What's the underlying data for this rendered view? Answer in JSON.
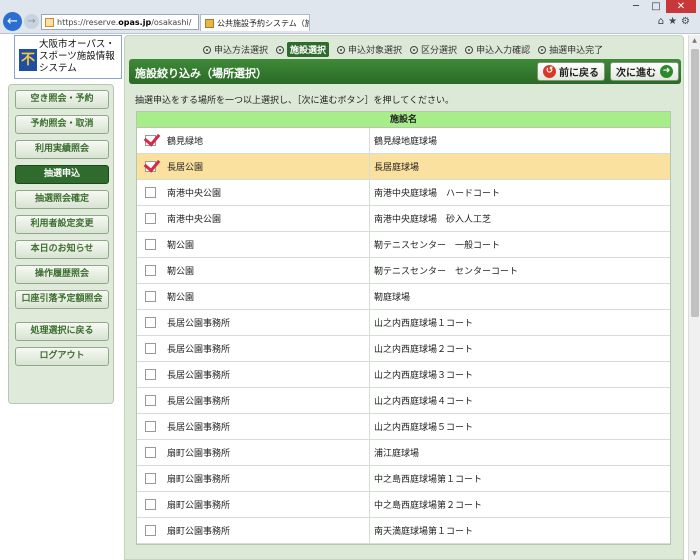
{
  "browser": {
    "url_prefix": "https://reserve.",
    "url_host": "opas.jp",
    "url_suffix": "/osakashi/",
    "address_icons": "ρ ▾ 🔒 C",
    "tab_title": "公共施設予約システム（施...",
    "tab_close": "×",
    "min": "─",
    "max": "□",
    "close": "✕"
  },
  "logo": {
    "title": "大阪市オーパス・スポーツ施設情報システム",
    "emblem": "不"
  },
  "sidebar": {
    "items": [
      {
        "label": "空き照会・予約",
        "active": false
      },
      {
        "label": "予約照会・取消",
        "active": false
      },
      {
        "label": "利用実績照会",
        "active": false
      },
      {
        "label": "抽選申込",
        "active": true
      },
      {
        "label": "抽選照会確定",
        "active": false
      },
      {
        "label": "利用者設定変更",
        "active": false
      },
      {
        "label": "本日のお知らせ",
        "active": false
      },
      {
        "label": "操作履歴照会",
        "active": false
      },
      {
        "label": "口座引落予定額照会",
        "active": false
      },
      {
        "label": "処理選択に戻る",
        "active": false
      },
      {
        "label": "ログアウト",
        "active": false
      }
    ]
  },
  "steps": [
    {
      "label": "申込方法選択",
      "current": false
    },
    {
      "label": "施設選択",
      "current": true
    },
    {
      "label": "申込対象選択",
      "current": false
    },
    {
      "label": "区分選択",
      "current": false
    },
    {
      "label": "申込入力確認",
      "current": false
    },
    {
      "label": "抽選申込完了",
      "current": false
    }
  ],
  "header": {
    "title": "施設絞り込み（場所選択）",
    "back_label": "前に戻る",
    "next_label": "次に進む"
  },
  "instruction": "抽選申込をする場所を一つ以上選択し、［次に進むボタン］を押してください。",
  "table": {
    "header": "施設名",
    "rows": [
      {
        "place": "鶴見緑地",
        "facility": "鶴見緑地庭球場",
        "checked": true,
        "selected": false
      },
      {
        "place": "長居公園",
        "facility": "長居庭球場",
        "checked": true,
        "selected": true
      },
      {
        "place": "南港中央公園",
        "facility": "南港中央庭球場　ハードコート",
        "checked": false,
        "selected": false
      },
      {
        "place": "南港中央公園",
        "facility": "南港中央庭球場　砂入人工芝",
        "checked": false,
        "selected": false
      },
      {
        "place": "靭公園",
        "facility": "靭テニスセンター　一般コート",
        "checked": false,
        "selected": false
      },
      {
        "place": "靭公園",
        "facility": "靭テニスセンター　センターコート",
        "checked": false,
        "selected": false
      },
      {
        "place": "靭公園",
        "facility": "靭庭球場",
        "checked": false,
        "selected": false
      },
      {
        "place": "長居公園事務所",
        "facility": "山之内西庭球場１コート",
        "checked": false,
        "selected": false
      },
      {
        "place": "長居公園事務所",
        "facility": "山之内西庭球場２コート",
        "checked": false,
        "selected": false
      },
      {
        "place": "長居公園事務所",
        "facility": "山之内西庭球場３コート",
        "checked": false,
        "selected": false
      },
      {
        "place": "長居公園事務所",
        "facility": "山之内西庭球場４コート",
        "checked": false,
        "selected": false
      },
      {
        "place": "長居公園事務所",
        "facility": "山之内西庭球場５コート",
        "checked": false,
        "selected": false
      },
      {
        "place": "扇町公園事務所",
        "facility": "浦江庭球場",
        "checked": false,
        "selected": false
      },
      {
        "place": "扇町公園事務所",
        "facility": "中之島西庭球場第１コート",
        "checked": false,
        "selected": false
      },
      {
        "place": "扇町公園事務所",
        "facility": "中之島西庭球場第２コート",
        "checked": false,
        "selected": false
      },
      {
        "place": "扇町公園事務所",
        "facility": "南天満庭球場第１コート",
        "checked": false,
        "selected": false
      }
    ]
  }
}
